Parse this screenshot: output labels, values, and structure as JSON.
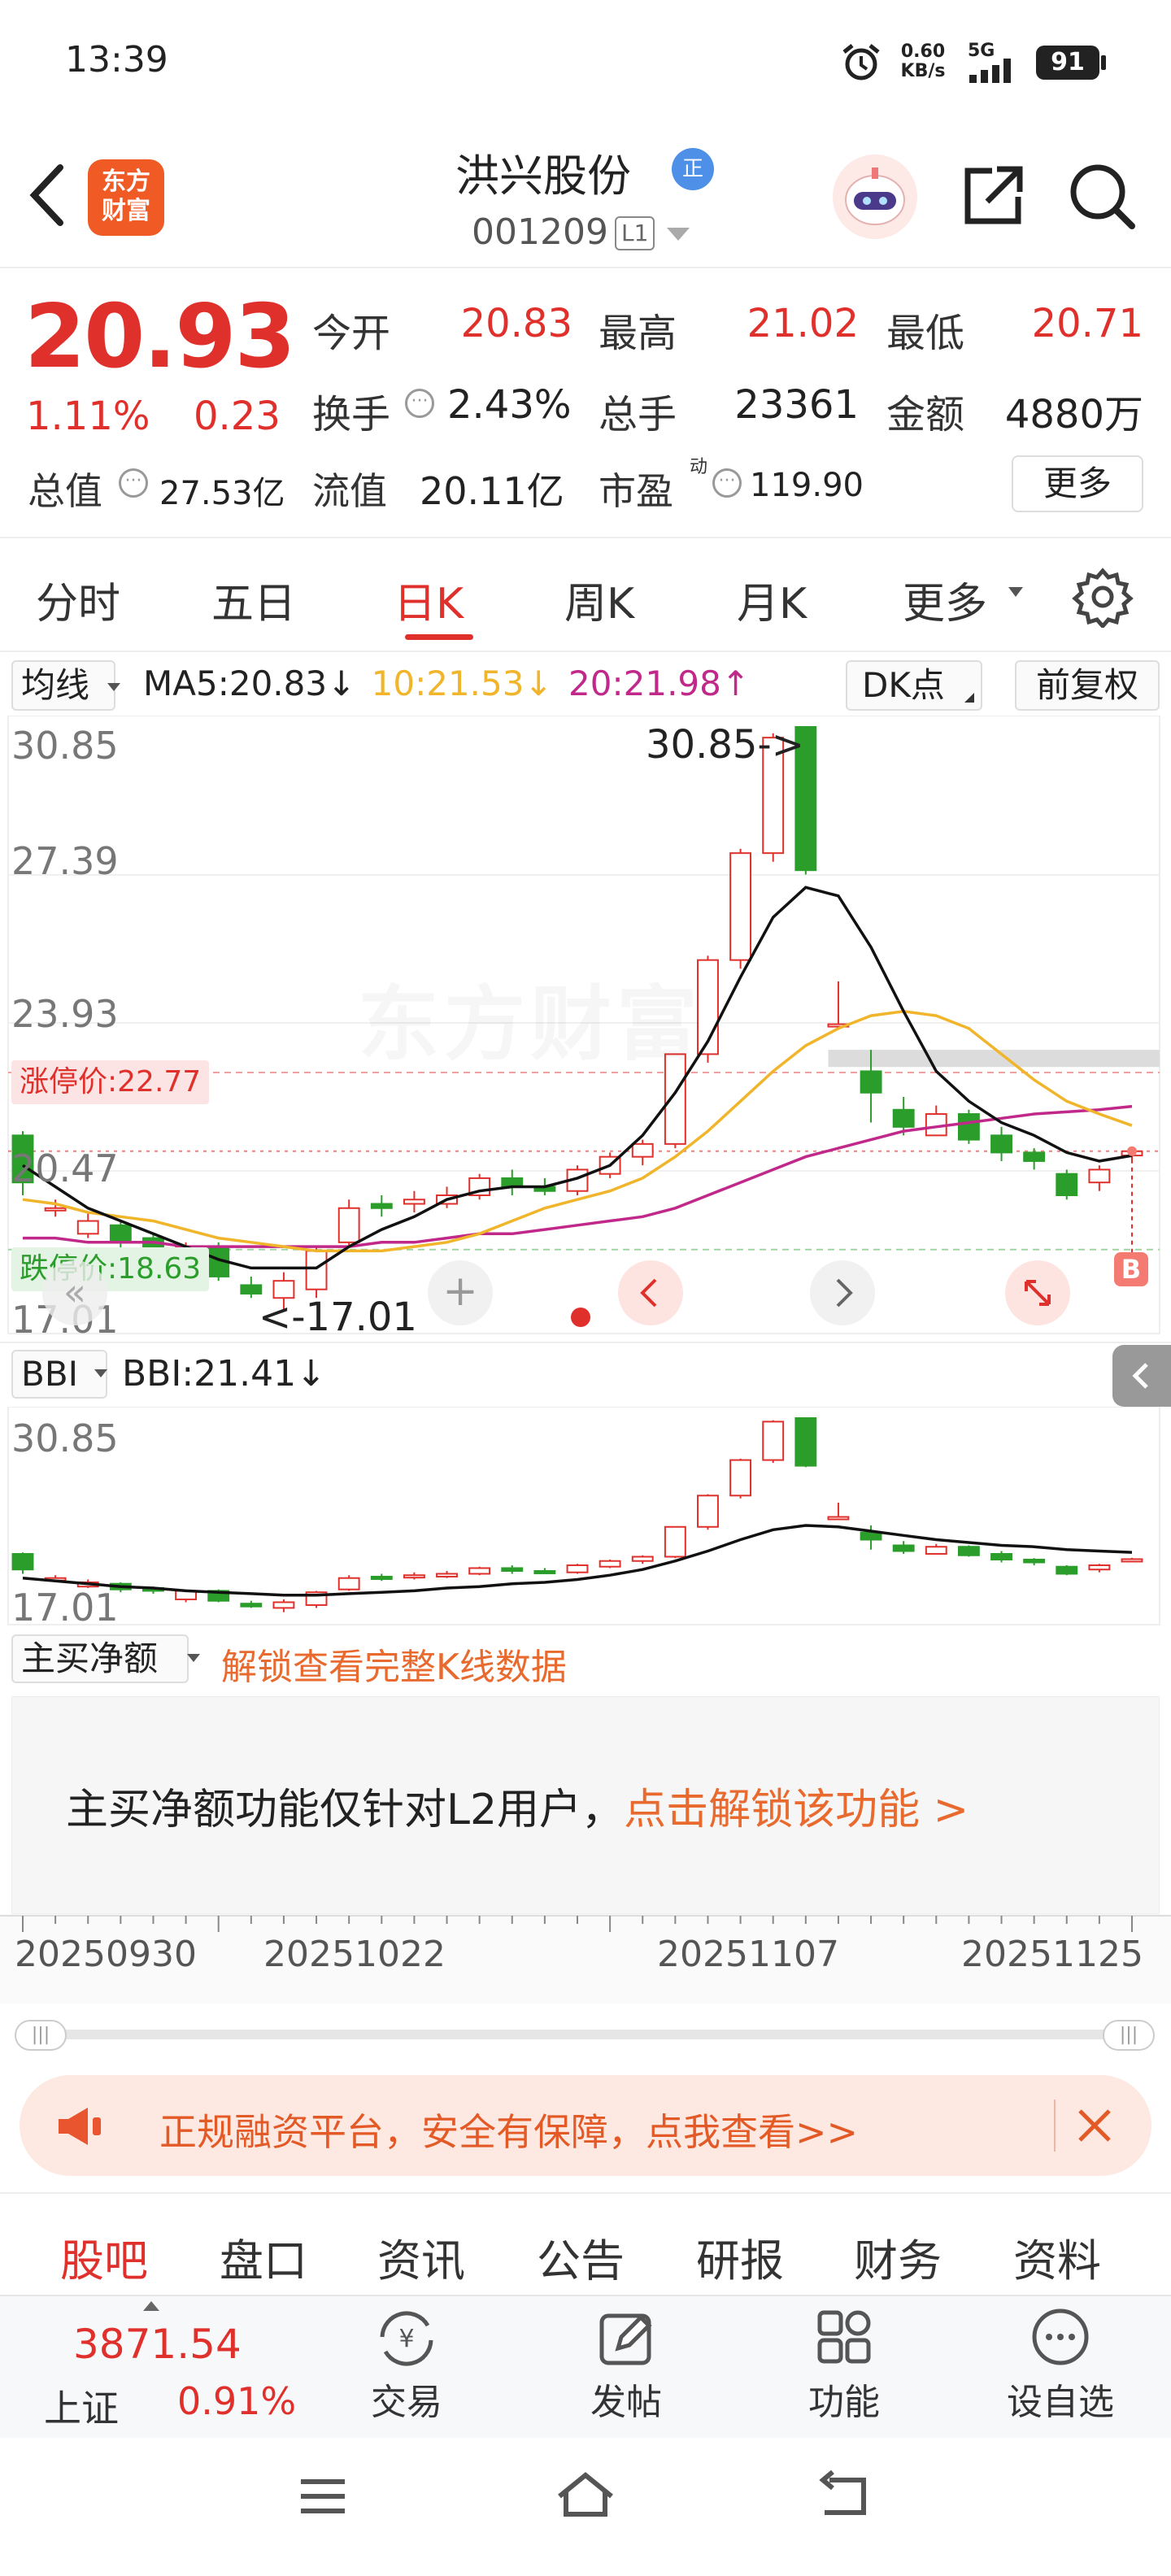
{
  "status_bar": {
    "time": "13:39",
    "net_speed": "0.60",
    "net_unit": "KB/s",
    "signal": "5G",
    "battery": "91"
  },
  "header": {
    "logo_line1": "东方",
    "logo_line2": "财富",
    "stock_name": "洪兴股份",
    "badge": "正",
    "code": "001209",
    "level": "L1"
  },
  "quote": {
    "price": "20.93",
    "change_pct": "1.11%",
    "change": "0.23",
    "fields": [
      {
        "label": "今开",
        "value": "20.83"
      },
      {
        "label": "最高",
        "value": "21.02"
      },
      {
        "label": "最低",
        "value": "20.71"
      },
      {
        "label": "换手",
        "value": "2.43%"
      },
      {
        "label": "总手",
        "value": "23361"
      },
      {
        "label": "金额",
        "value": "4880万"
      },
      {
        "label": "总值",
        "value": "27.53亿"
      },
      {
        "label": "流值",
        "value": "20.11亿"
      },
      {
        "label": "市盈",
        "sup": "动",
        "value": "119.90"
      }
    ],
    "more": "更多"
  },
  "tabs": [
    {
      "label": "分时"
    },
    {
      "label": "五日"
    },
    {
      "label": "日K"
    },
    {
      "label": "周K"
    },
    {
      "label": "月K"
    },
    {
      "label": "更多"
    }
  ],
  "ma_bar": {
    "selector": "均线",
    "ma5": "MA5:20.83",
    "ma5_arrow": "↓",
    "ma10": "10:21.53",
    "ma10_arrow": "↓",
    "ma20": "20:21.98",
    "ma20_arrow": "↑",
    "dk": "DK点",
    "adjust": "前复权"
  },
  "main_chart": {
    "y_labels": [
      "30.85",
      "27.39",
      "23.93",
      "20.47",
      "17.01"
    ],
    "limit_up": "涨停价:22.77",
    "limit_down": "跌停价:18.63",
    "high_note": "30.85->",
    "low_note": "<-17.01",
    "watermark": "东方财富",
    "b_marker": "B"
  },
  "bbi": {
    "selector": "BBI",
    "value": "BBI:21.41",
    "arrow": "↓",
    "y_top": "30.85",
    "y_bottom": "17.01"
  },
  "netbuy": {
    "selector": "主买净额",
    "unlock": "解锁查看完整K线数据",
    "msg": "主买净额功能仅针对L2用户，",
    "link": "点击解锁该功能 >"
  },
  "x_dates": [
    "20250930",
    "20251022",
    "20251107",
    "20251125"
  ],
  "ad_banner": {
    "text": "正规融资平台，安全有保障，点我查看>>"
  },
  "bottom_tabs": [
    {
      "label": "股吧"
    },
    {
      "label": "盘口"
    },
    {
      "label": "资讯"
    },
    {
      "label": "公告"
    },
    {
      "label": "研报"
    },
    {
      "label": "财务"
    },
    {
      "label": "资料"
    }
  ],
  "index": {
    "value": "3871.54",
    "name": "上证",
    "pct": "0.91%"
  },
  "bottom_actions": [
    {
      "label": "交易"
    },
    {
      "label": "发帖"
    },
    {
      "label": "功能"
    },
    {
      "label": "设自选"
    }
  ],
  "chart_data": {
    "type": "candlestick",
    "ylim": [
      17.01,
      30.85
    ],
    "candles": [
      [
        21.3,
        20.2,
        21.4,
        19.9
      ],
      [
        19.6,
        19.6,
        19.8,
        19.4
      ],
      [
        19.0,
        19.3,
        19.5,
        18.9
      ],
      [
        19.2,
        18.8,
        19.3,
        18.6
      ],
      [
        18.9,
        18.7,
        19.0,
        18.5
      ],
      [
        18.1,
        18.7,
        18.8,
        17.9
      ],
      [
        18.7,
        18.0,
        18.8,
        17.9
      ],
      [
        17.8,
        17.6,
        18.0,
        17.5
      ],
      [
        17.5,
        17.9,
        18.1,
        17.2
      ],
      [
        17.7,
        18.6,
        18.7,
        17.5
      ],
      [
        18.8,
        19.6,
        19.8,
        18.7
      ],
      [
        19.7,
        19.6,
        19.9,
        19.4
      ],
      [
        19.7,
        19.8,
        20.0,
        19.5
      ],
      [
        19.7,
        19.9,
        20.1,
        19.6
      ],
      [
        19.9,
        20.3,
        20.4,
        19.8
      ],
      [
        20.3,
        20.1,
        20.5,
        19.9
      ],
      [
        20.1,
        20.0,
        20.3,
        19.9
      ],
      [
        20.0,
        20.5,
        20.6,
        19.9
      ],
      [
        20.4,
        20.8,
        20.9,
        20.3
      ],
      [
        20.8,
        21.1,
        21.2,
        20.6
      ],
      [
        21.1,
        23.2,
        23.2,
        21.0
      ],
      [
        23.2,
        25.4,
        25.5,
        23.0
      ],
      [
        25.4,
        27.9,
        28.0,
        25.2
      ],
      [
        27.9,
        30.6,
        30.7,
        27.7
      ],
      [
        30.85,
        27.5,
        30.85,
        27.4
      ],
      [
        23.9,
        23.9,
        24.9,
        23.9
      ],
      [
        22.8,
        22.3,
        23.3,
        21.6
      ],
      [
        21.9,
        21.5,
        22.2,
        21.3
      ],
      [
        21.3,
        21.8,
        22.0,
        21.3
      ],
      [
        21.8,
        21.2,
        21.9,
        21.1
      ],
      [
        21.3,
        20.9,
        21.5,
        20.7
      ],
      [
        20.9,
        20.7,
        21.0,
        20.5
      ],
      [
        20.4,
        19.9,
        20.5,
        19.8
      ],
      [
        20.2,
        20.5,
        20.6,
        20.0
      ],
      [
        20.83,
        20.93,
        21.02,
        20.71
      ]
    ],
    "ma5": [
      20.6,
      20.1,
      19.6,
      19.3,
      19.0,
      18.7,
      18.4,
      18.2,
      18.2,
      18.2,
      18.7,
      19.1,
      19.4,
      19.8,
      20.0,
      20.1,
      20.1,
      20.3,
      20.6,
      21.3,
      22.3,
      23.5,
      25.0,
      26.4,
      27.1,
      26.9,
      25.7,
      24.2,
      22.8,
      22.1,
      21.6,
      21.3,
      20.9,
      20.7,
      20.83
    ],
    "ma10": [
      19.8,
      19.7,
      19.5,
      19.4,
      19.3,
      19.1,
      18.9,
      18.8,
      18.7,
      18.6,
      18.6,
      18.6,
      18.7,
      18.8,
      19.0,
      19.3,
      19.6,
      19.8,
      20.0,
      20.3,
      20.8,
      21.4,
      22.1,
      22.8,
      23.4,
      23.8,
      24.1,
      24.2,
      24.1,
      23.8,
      23.2,
      22.6,
      22.1,
      21.8,
      21.53
    ],
    "ma20": [
      18.9,
      18.9,
      18.8,
      18.8,
      18.8,
      18.7,
      18.7,
      18.7,
      18.7,
      18.7,
      18.7,
      18.8,
      18.8,
      18.9,
      19.0,
      19.0,
      19.1,
      19.2,
      19.3,
      19.4,
      19.6,
      19.9,
      20.2,
      20.5,
      20.8,
      21.0,
      21.2,
      21.4,
      21.5,
      21.6,
      21.7,
      21.8,
      21.85,
      21.9,
      21.98
    ],
    "bbi": [
      19.6,
      19.4,
      19.2,
      19.0,
      18.9,
      18.7,
      18.6,
      18.5,
      18.4,
      18.4,
      18.5,
      18.6,
      18.7,
      18.9,
      19.0,
      19.2,
      19.3,
      19.5,
      19.8,
      20.2,
      20.8,
      21.5,
      22.3,
      23.0,
      23.3,
      23.2,
      22.9,
      22.6,
      22.3,
      22.1,
      21.9,
      21.8,
      21.6,
      21.5,
      21.41
    ]
  }
}
